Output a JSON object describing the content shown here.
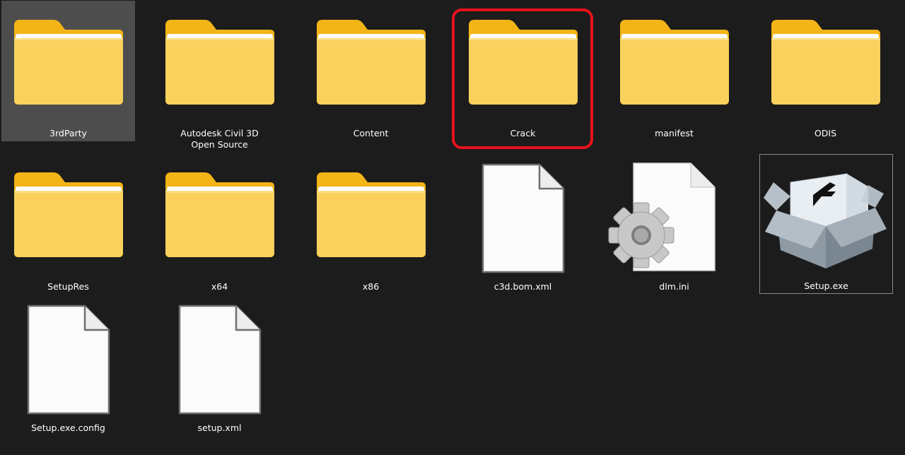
{
  "items": [
    {
      "name": "3rdParty",
      "type": "folder",
      "icon": "folder-icon",
      "selected": true
    },
    {
      "name": "Autodesk Civil 3D Open Source",
      "type": "folder",
      "icon": "folder-icon"
    },
    {
      "name": "Content",
      "type": "folder",
      "icon": "folder-icon"
    },
    {
      "name": "Crack",
      "type": "folder",
      "icon": "folder-icon",
      "highlighted": true
    },
    {
      "name": "manifest",
      "type": "folder",
      "icon": "folder-icon"
    },
    {
      "name": "ODIS",
      "type": "folder",
      "icon": "folder-icon"
    },
    {
      "name": "SetupRes",
      "type": "folder",
      "icon": "folder-icon"
    },
    {
      "name": "x64",
      "type": "folder",
      "icon": "folder-icon"
    },
    {
      "name": "x86",
      "type": "folder",
      "icon": "folder-icon"
    },
    {
      "name": "c3d.bom.xml",
      "type": "file",
      "icon": "document-icon"
    },
    {
      "name": "dlm.ini",
      "type": "file",
      "icon": "settings-document-icon"
    },
    {
      "name": "Setup.exe",
      "type": "file",
      "icon": "setup-box-icon",
      "focused": true
    },
    {
      "name": "Setup.exe.config",
      "type": "file",
      "icon": "document-icon"
    },
    {
      "name": "setup.xml",
      "type": "file",
      "icon": "document-icon"
    }
  ],
  "colors": {
    "background": "#1c1c1c",
    "selection": "#4d4d4d",
    "highlight_border": "#e8121c",
    "folder_front": "#f9d15c",
    "folder_back": "#f2b417"
  }
}
